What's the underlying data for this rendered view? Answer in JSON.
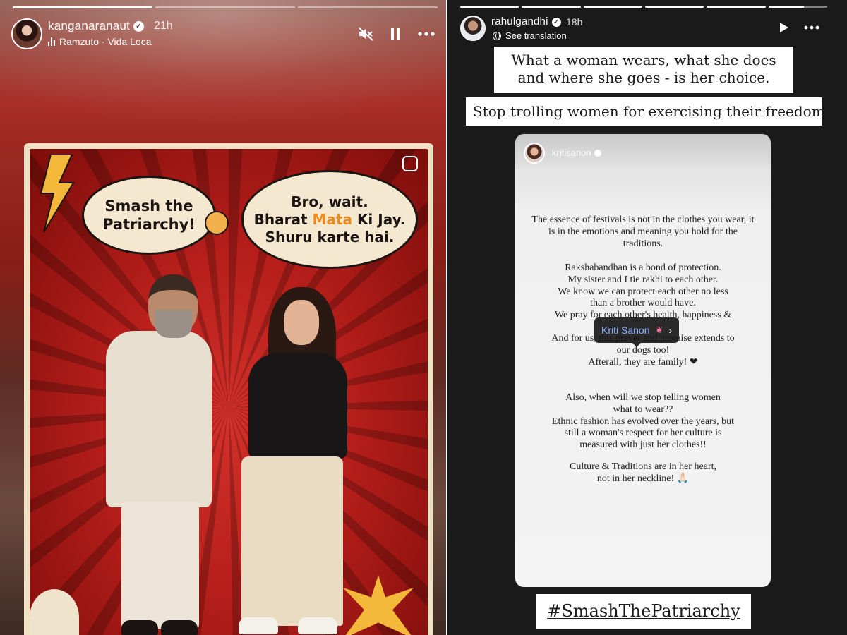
{
  "left_story": {
    "username": "kanganaranaut",
    "time": "21h",
    "music": "Ramzuto · Vida Loca",
    "progress": [
      1,
      0,
      0
    ],
    "icons": {
      "mute": "muted-speaker-icon",
      "pause": "pause-icon",
      "more": "more-icon"
    },
    "poster": {
      "bubble_left": [
        "Smash the",
        "Patriarchy!"
      ],
      "bubble_right_line1": "Bro, wait.",
      "bubble_right_line2_a": "Bharat",
      "bubble_right_line2_highlight": "Mata",
      "bubble_right_line2_b": "Ki Jay.",
      "bubble_right_line3": "Shuru karte hai.",
      "highlight_color": "#f08a1c"
    }
  },
  "right_story": {
    "username": "rahulgandhi",
    "time": "18h",
    "see_translation": "See translation",
    "progress": [
      1,
      1,
      1,
      1,
      1,
      0.6
    ],
    "icons": {
      "play": "play-icon",
      "more": "more-icon"
    },
    "caption_1": "What a woman wears, what she does and where she goes - is her choice.",
    "caption_2": "Stop trolling women for exercising their freedom.",
    "shared_post": {
      "username": "kritisanon",
      "paragraph_1": "The essence of festivals is not in the clothes you wear, it is in the emotions and meaning you hold for the traditions.",
      "paragraph_2_lines": [
        "Rakshabandhan is a bond of protection.",
        "My sister and I tie rakhi to each other.",
        "We know we can protect each other no less",
        "than a brother would have.",
        "We pray for each other's health, happiness &"
      ],
      "paragraph_3_lines": [
        "And for us, this prayer and promise extends to",
        "our dogs too!",
        "Afterall, they are family! ❤"
      ],
      "paragraph_4_lines": [
        "Also, when will we stop telling women",
        "what to wear??",
        "Ethnic fashion has evolved over the years, but",
        "still a woman's respect for her culture is",
        "measured with just her clothes!!"
      ],
      "paragraph_5_lines": [
        "Culture & Traditions are in her heart,",
        "not in her neckline! 🙏🏻"
      ],
      "mention_tag": "Kriti Sanon",
      "mention_tag_icon": "butterfly-icon"
    },
    "hashtag": "#SmashThePatriarchy"
  }
}
